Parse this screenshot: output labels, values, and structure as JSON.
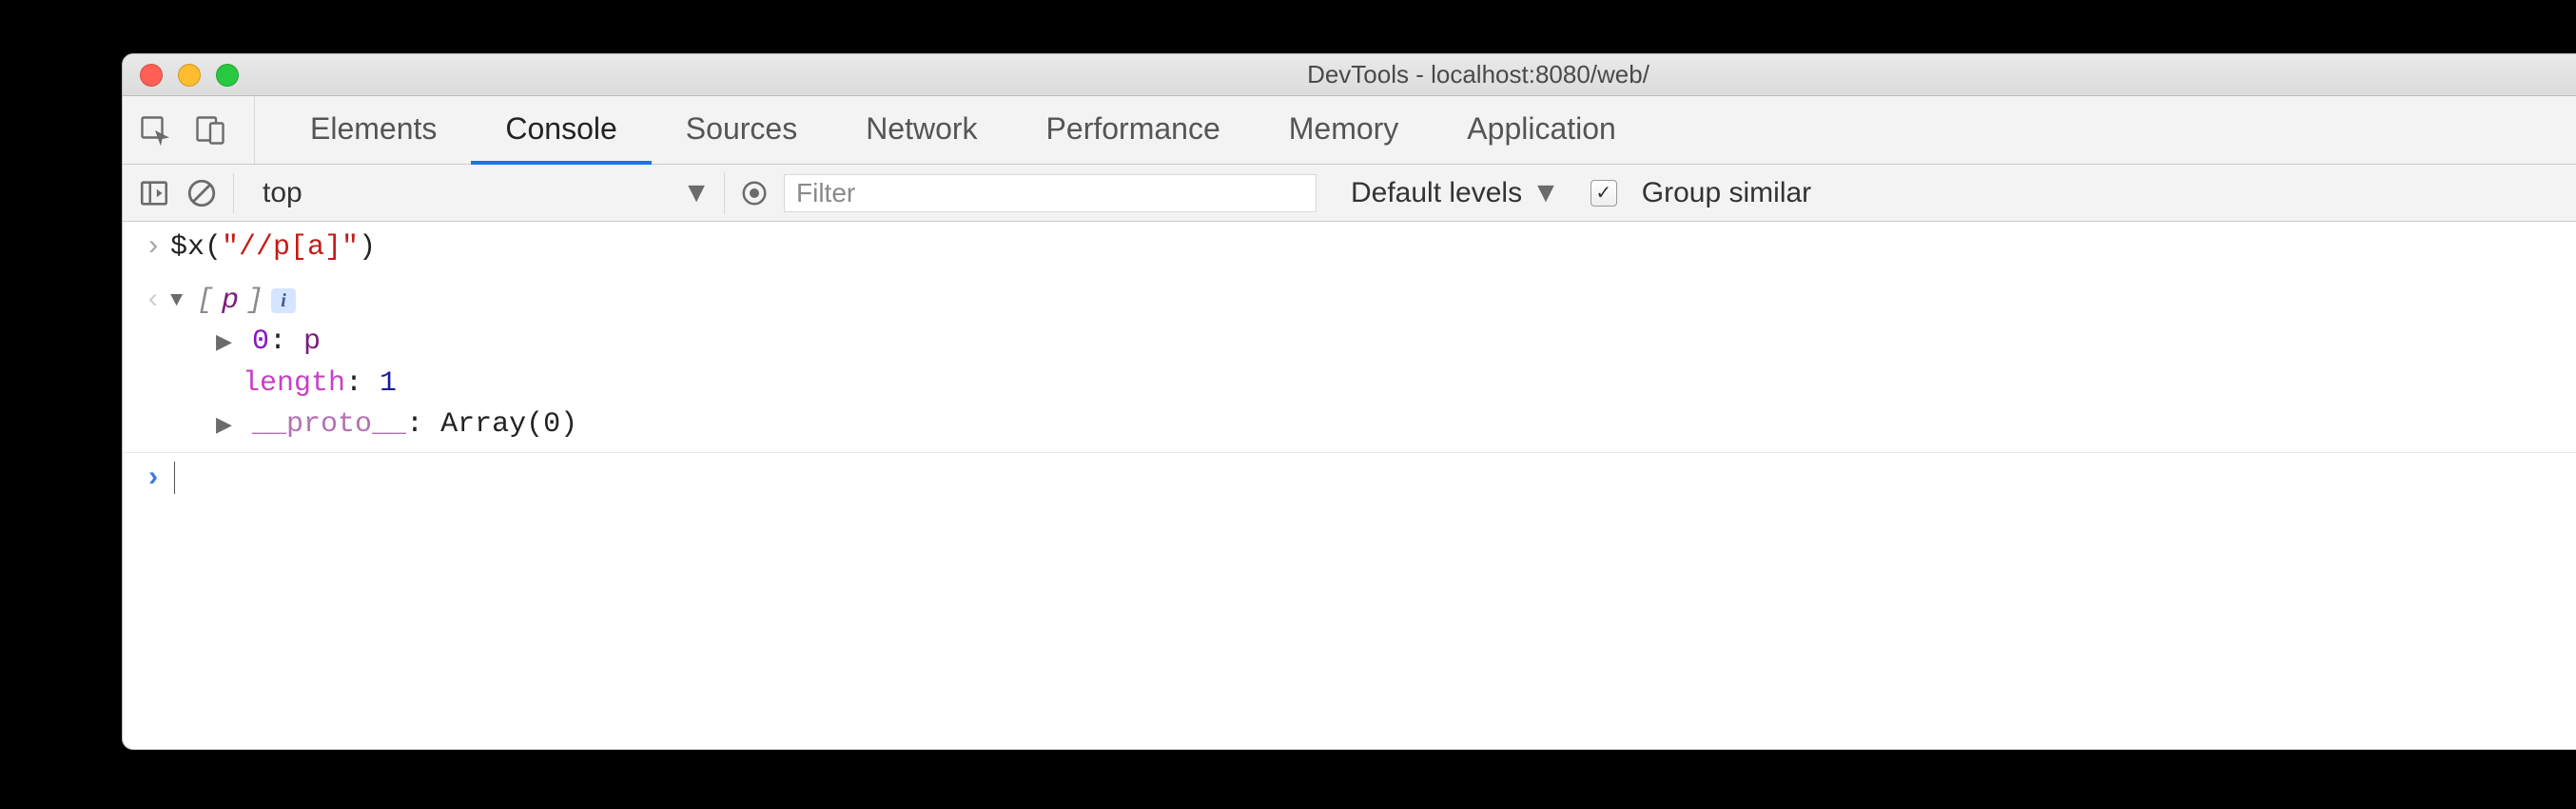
{
  "window": {
    "title": "DevTools - localhost:8080/web/"
  },
  "tabs": {
    "items": [
      {
        "label": "Elements"
      },
      {
        "label": "Console"
      },
      {
        "label": "Sources"
      },
      {
        "label": "Network"
      },
      {
        "label": "Performance"
      },
      {
        "label": "Memory"
      },
      {
        "label": "Application"
      }
    ],
    "active_index": 1
  },
  "toolbar": {
    "context": "top",
    "filter_placeholder": "Filter",
    "levels_label": "Default levels",
    "group_similar_checked": true,
    "group_similar_label": "Group similar"
  },
  "console": {
    "input": {
      "fn": "$x",
      "arg": "\"//p[a]\""
    },
    "output": {
      "summary_prefix": "[",
      "summary_item": "p",
      "summary_suffix": "]",
      "items": [
        {
          "key": "0",
          "value": "p"
        }
      ],
      "length_key": "length",
      "length_value": "1",
      "proto_key": "__proto__",
      "proto_value": "Array(0)"
    }
  }
}
